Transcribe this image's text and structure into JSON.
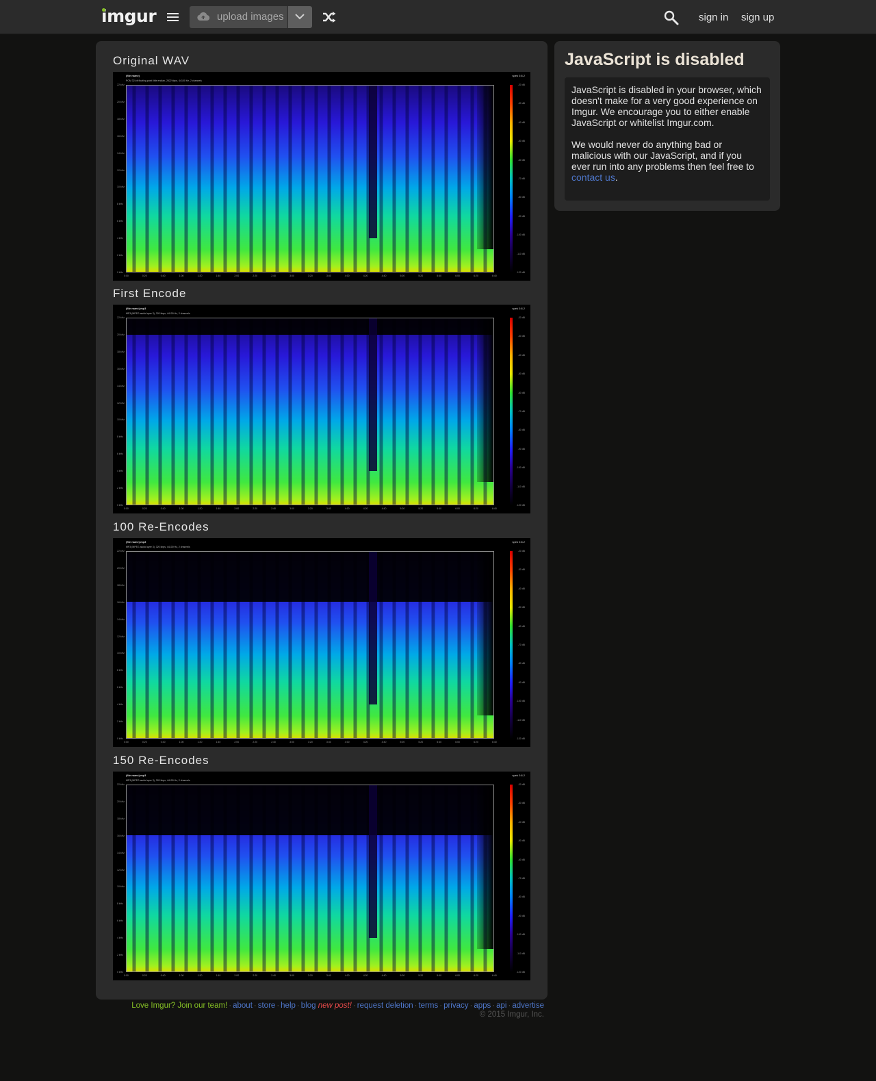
{
  "header": {
    "logo": "imgur",
    "upload_label": "upload images",
    "sign_in": "sign in",
    "sign_up": "sign up",
    "icons": [
      "menu-icon",
      "cloud-upload-icon",
      "chevron-down-icon",
      "shuffle-icon",
      "search-icon"
    ]
  },
  "post": {
    "images": [
      {
        "title": "Original WAV",
        "file_name": "(file name)",
        "file_info": "PCM 32-bit floating point little endian, 2822 kbps, 44100 Hz, 2 channels",
        "lowpass_fraction": 1.0
      },
      {
        "title": "First Encode",
        "file_name": "(file name).mp3",
        "file_info": "MP3 (MPEG audio layer 3), 320 kbps, 44100 Hz, 2 channels",
        "lowpass_fraction": 0.91
      },
      {
        "title": "100 Re-Encodes",
        "file_name": "(file name).mp3",
        "file_info": "MP3 (MPEG audio layer 3), 320 kbps, 44100 Hz, 2 channels",
        "lowpass_fraction": 0.73
      },
      {
        "title": "150 Re-Encodes",
        "file_name": "(file name).mp3",
        "file_info": "MP3 (MPEG audio layer 3), 320 kbps, 44100 Hz, 2 channels",
        "lowpass_fraction": 0.73
      }
    ],
    "spectrogram": {
      "brand": "spek 0.8.2",
      "freq_labels": [
        "22 kHz",
        "20 kHz",
        "18 kHz",
        "16 kHz",
        "14 kHz",
        "12 kHz",
        "10 kHz",
        "8 kHz",
        "6 kHz",
        "4 kHz",
        "2 kHz",
        "0 kHz"
      ],
      "db_labels": [
        "-20 dB",
        "-30 dB",
        "-40 dB",
        "-50 dB",
        "-60 dB",
        "-70 dB",
        "-80 dB",
        "-90 dB",
        "-100 dB",
        "-110 dB",
        "-120 dB"
      ],
      "time_labels": [
        "0:00",
        "0:20",
        "0:40",
        "1:00",
        "1:20",
        "1:40",
        "2:00",
        "2:20",
        "2:40",
        "3:00",
        "3:20",
        "3:40",
        "4:00",
        "4:20",
        "4:40",
        "5:00",
        "5:20",
        "5:40",
        "6:00",
        "6:20",
        "6:40"
      ]
    }
  },
  "sidebar": {
    "title": "JavaScript is disabled",
    "para1": "JavaScript is disabled in your browser, which doesn't make for a very good experience on Imgur. We encourage you to either enable JavaScript or whitelist Imgur.com.",
    "para2_text": "We would never do anything bad or malicious with our JavaScript, and if you ever run into any problems then feel free to",
    "para2_link": "contact us",
    "para2_end": "."
  },
  "footer": {
    "join": "Love Imgur? Join our team!",
    "links": [
      "about",
      "store",
      "help",
      "blog"
    ],
    "new_post": "new post!",
    "links2": [
      "request deletion",
      "terms",
      "privacy",
      "apps",
      "api",
      "advertise"
    ],
    "copyright": "© 2015 Imgur, Inc."
  },
  "colors": {
    "accent_green": "#85bf25",
    "link_blue": "#4e76c9",
    "panel": "#2b2b2b",
    "background": "#121211"
  }
}
